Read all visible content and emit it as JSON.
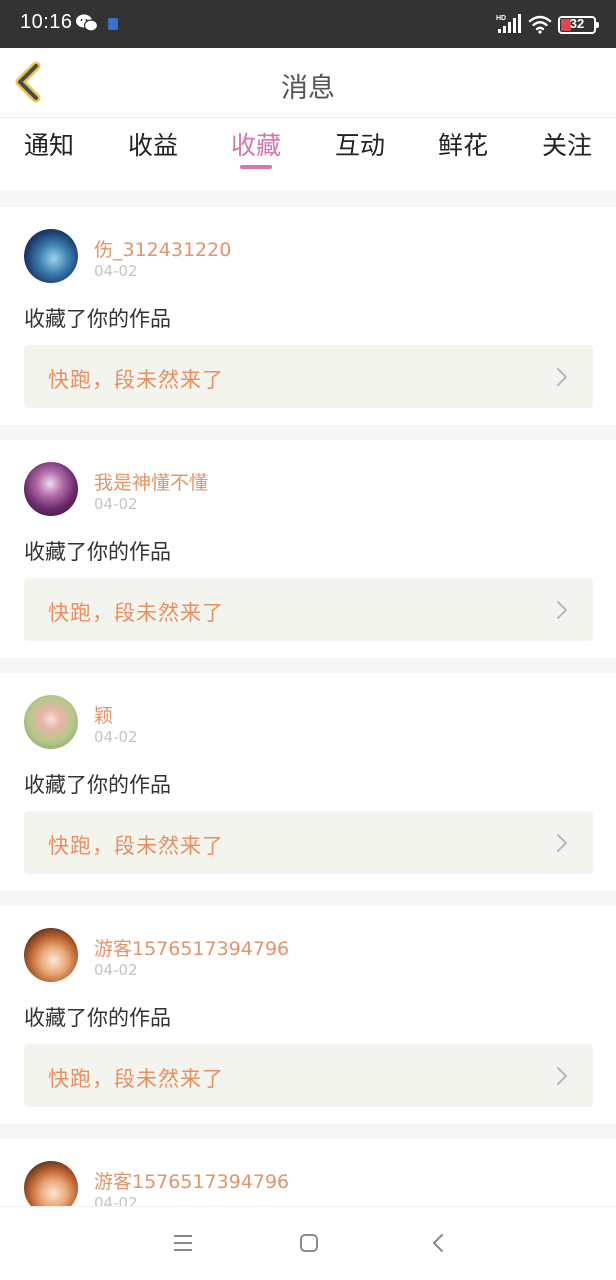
{
  "status_bar": {
    "time": "10:16",
    "battery": "32",
    "network": "HD"
  },
  "header": {
    "title": "消息"
  },
  "tabs": [
    {
      "label": "通知"
    },
    {
      "label": "收益"
    },
    {
      "label": "收藏"
    },
    {
      "label": "互动"
    },
    {
      "label": "鲜花"
    },
    {
      "label": "关注"
    }
  ],
  "active_tab": "收藏",
  "colors": {
    "accent": "#d975a8",
    "username": "#e4946a",
    "work_title": "#eb8e5e",
    "status_bar": "#333333"
  },
  "messages": [
    {
      "username": "伤_312431220",
      "date": "04-02",
      "action": "收藏了你的作品",
      "work_title": "快跑，段未然来了"
    },
    {
      "username": "我是神懂不懂",
      "date": "04-02",
      "action": "收藏了你的作品",
      "work_title": "快跑，段未然来了"
    },
    {
      "username": "颖",
      "date": "04-02",
      "action": "收藏了你的作品",
      "work_title": "快跑，段未然来了"
    },
    {
      "username": "游客1576517394796",
      "date": "04-02",
      "action": "收藏了你的作品",
      "work_title": "快跑，段未然来了"
    },
    {
      "username": "游客1576517394796",
      "date": "04-02"
    }
  ]
}
